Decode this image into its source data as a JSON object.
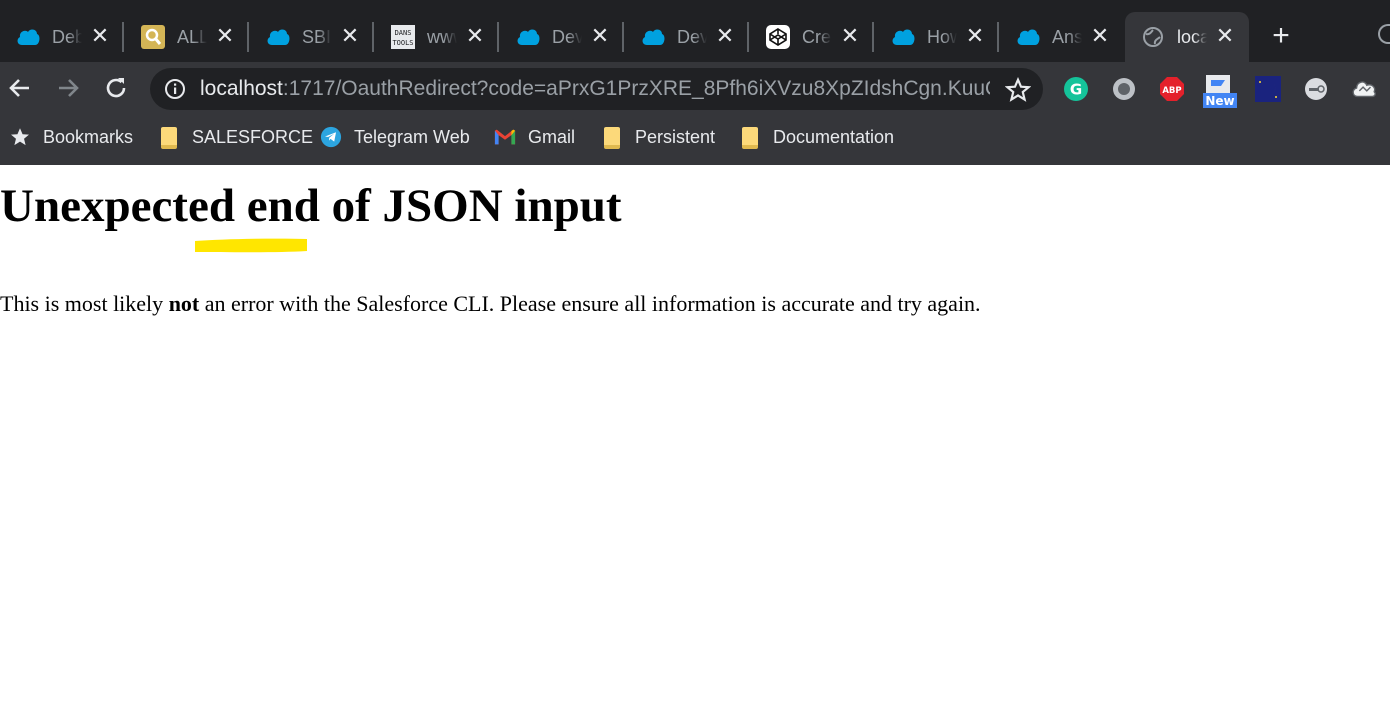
{
  "browser": {
    "tabs": [
      {
        "title": "Deb",
        "favicon": "salesforce-cloud-icon"
      },
      {
        "title": "ALL",
        "favicon": "search-magnifier-icon"
      },
      {
        "title": "SBII",
        "favicon": "salesforce-cloud-icon"
      },
      {
        "title": "www",
        "favicon": "dans-tools-icon"
      },
      {
        "title": "Dev",
        "favicon": "salesforce-cloud-icon"
      },
      {
        "title": "Dev",
        "favicon": "salesforce-cloud-icon"
      },
      {
        "title": "Cre",
        "favicon": "codepen-icon"
      },
      {
        "title": "How",
        "favicon": "salesforce-cloud-icon"
      },
      {
        "title": "Ans",
        "favicon": "salesforce-cloud-icon"
      },
      {
        "title": "loca",
        "favicon": "globe-icon",
        "active": true
      }
    ],
    "new_tab_icon": "plus-icon",
    "dans_tools_text": "DANS TOOLS",
    "address": {
      "host": "localhost",
      "path": ":1717/OauthRedirect?code=aPrxG1PrzXRE_8Pfh6iXVzu8XpZIdshCgn.KuuQ..."
    },
    "extensions": [
      {
        "name": "grammarly-extension-icon",
        "label": "G"
      },
      {
        "name": "circle-extension-icon",
        "label": ""
      },
      {
        "name": "adblock-plus-extension-icon",
        "label": "ABP"
      },
      {
        "name": "new-badge-extension-icon",
        "label": "New"
      },
      {
        "name": "night-mode-extension-icon",
        "label": ""
      },
      {
        "name": "toggle-extension-icon",
        "label": ""
      },
      {
        "name": "cloud-extension-icon",
        "label": ""
      }
    ],
    "bookmarks": [
      {
        "label": "Bookmarks",
        "icon": "star-icon"
      },
      {
        "label": "SALESFORCE",
        "icon": "folder-icon"
      },
      {
        "label": "Telegram Web",
        "icon": "telegram-icon"
      },
      {
        "label": "Gmail",
        "icon": "gmail-icon"
      },
      {
        "label": "Persistent",
        "icon": "folder-icon"
      },
      {
        "label": "Documentation",
        "icon": "folder-icon"
      }
    ]
  },
  "page": {
    "title": "Unexpected end of JSON input",
    "message_before": "This is most likely ",
    "message_bold": "not",
    "message_after": " an error with the Salesforce CLI. Please ensure all information is accurate and try again."
  },
  "colors": {
    "tabstrip_bg": "#202124",
    "toolbar_bg": "#35363a",
    "highlight": "#ffe600",
    "salesforce_blue": "#00a1e0"
  }
}
